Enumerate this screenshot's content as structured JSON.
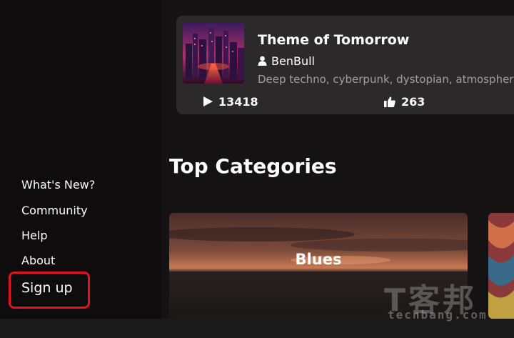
{
  "sidebar": {
    "links": [
      {
        "label": "What's New?"
      },
      {
        "label": "Community"
      },
      {
        "label": "Help"
      },
      {
        "label": "About"
      }
    ],
    "signup_label": "Sign up"
  },
  "featured_song": {
    "title": "Theme of Tomorrow",
    "artist": "BenBull",
    "tags": "Deep techno, cyberpunk, dystopian, atmospheric",
    "plays": "13418",
    "likes": "263",
    "icons": {
      "artist": "user-icon",
      "plays": "play-icon",
      "likes": "thumbs-up-icon"
    }
  },
  "categories": {
    "title": "Top Categories",
    "items": [
      {
        "label": "Blues"
      }
    ]
  },
  "watermark": {
    "logo": "T客邦",
    "site": "techbang.com"
  },
  "colors": {
    "background": "#151213",
    "card": "#2c292a",
    "highlight": "#e0141e",
    "muted_text": "#a39fa1"
  }
}
